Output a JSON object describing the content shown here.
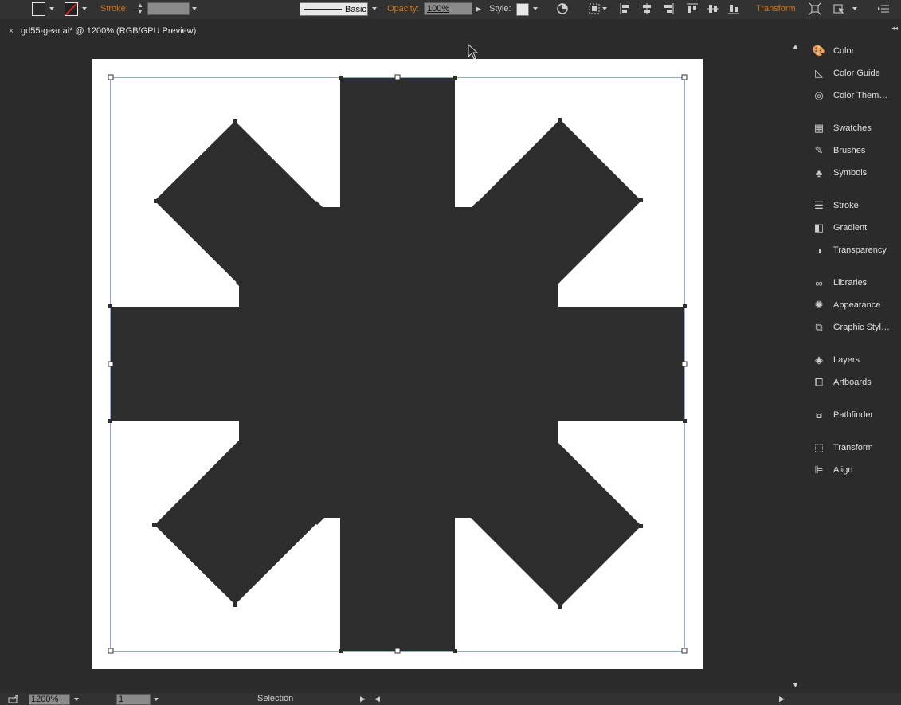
{
  "control_bar": {
    "stroke_label": "Stroke:",
    "brush_definition": "Basic",
    "opacity_label": "Opacity:",
    "opacity_value": "100%",
    "style_label": "Style:",
    "transform_label": "Transform"
  },
  "document_tab": {
    "title": "gd55-gear.ai* @ 1200% (RGB/GPU Preview)"
  },
  "panels": [
    {
      "label": "Color",
      "icon": "color-palette-icon"
    },
    {
      "label": "Color Guide",
      "icon": "color-guide-icon"
    },
    {
      "label": "Color Them…",
      "icon": "color-themes-icon"
    },
    {
      "label": "Swatches",
      "icon": "swatches-grid-icon"
    },
    {
      "label": "Brushes",
      "icon": "brushes-icon"
    },
    {
      "label": "Symbols",
      "icon": "symbols-club-icon"
    },
    {
      "label": "Stroke",
      "icon": "stroke-lines-icon"
    },
    {
      "label": "Gradient",
      "icon": "gradient-icon"
    },
    {
      "label": "Transparency",
      "icon": "transparency-icon"
    },
    {
      "label": "Libraries",
      "icon": "libraries-cc-icon"
    },
    {
      "label": "Appearance",
      "icon": "appearance-icon"
    },
    {
      "label": "Graphic Styl…",
      "icon": "graphic-styles-icon"
    },
    {
      "label": "Layers",
      "icon": "layers-icon"
    },
    {
      "label": "Artboards",
      "icon": "artboards-icon"
    },
    {
      "label": "Pathfinder",
      "icon": "pathfinder-icon"
    },
    {
      "label": "Transform",
      "icon": "transform-icon"
    },
    {
      "label": "Align",
      "icon": "align-icon"
    }
  ],
  "status_bar": {
    "zoom": "1200%",
    "artboard_number": "1",
    "tool_name": "Selection"
  },
  "colors": {
    "ui_background": "#2b2b2b",
    "artboard": "#ffffff",
    "shape_fill": "#2d2d2d",
    "selection": "#4a78f0",
    "accent_orange": "#c8761e"
  }
}
